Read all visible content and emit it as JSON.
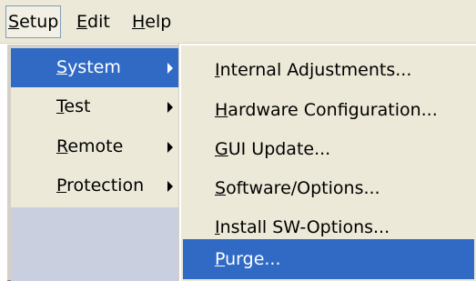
{
  "menubar": {
    "items": [
      {
        "label_pre": "",
        "mnemonic": "S",
        "label_post": "etup"
      },
      {
        "label_pre": "",
        "mnemonic": "E",
        "label_post": "dit"
      },
      {
        "label_pre": "",
        "mnemonic": "H",
        "label_post": "elp"
      }
    ]
  },
  "setup_menu": {
    "items": [
      {
        "mnemonic": "S",
        "label_post": "ystem",
        "has_submenu": true,
        "selected": true
      },
      {
        "mnemonic": "T",
        "label_post": "est",
        "has_submenu": true
      },
      {
        "mnemonic": "R",
        "label_post": "emote",
        "has_submenu": true
      },
      {
        "mnemonic": "P",
        "label_post": "rotection",
        "has_submenu": true
      }
    ]
  },
  "system_submenu": {
    "items": [
      {
        "mnemonic": "I",
        "label_post": "nternal Adjustments..."
      },
      {
        "mnemonic": "H",
        "label_post": "ardware Configuration..."
      },
      {
        "mnemonic": "G",
        "label_post": "UI Update..."
      },
      {
        "mnemonic": "S",
        "label_post": "oftware/Options..."
      },
      {
        "mnemonic": "I",
        "label_post": "nstall SW-Options..."
      },
      {
        "mnemonic": "P",
        "label_post": "urge...",
        "selected": true
      }
    ]
  },
  "colors": {
    "menu_background": "#ece9d8",
    "highlight": "#316ac5",
    "highlight_text": "#ffffff"
  }
}
